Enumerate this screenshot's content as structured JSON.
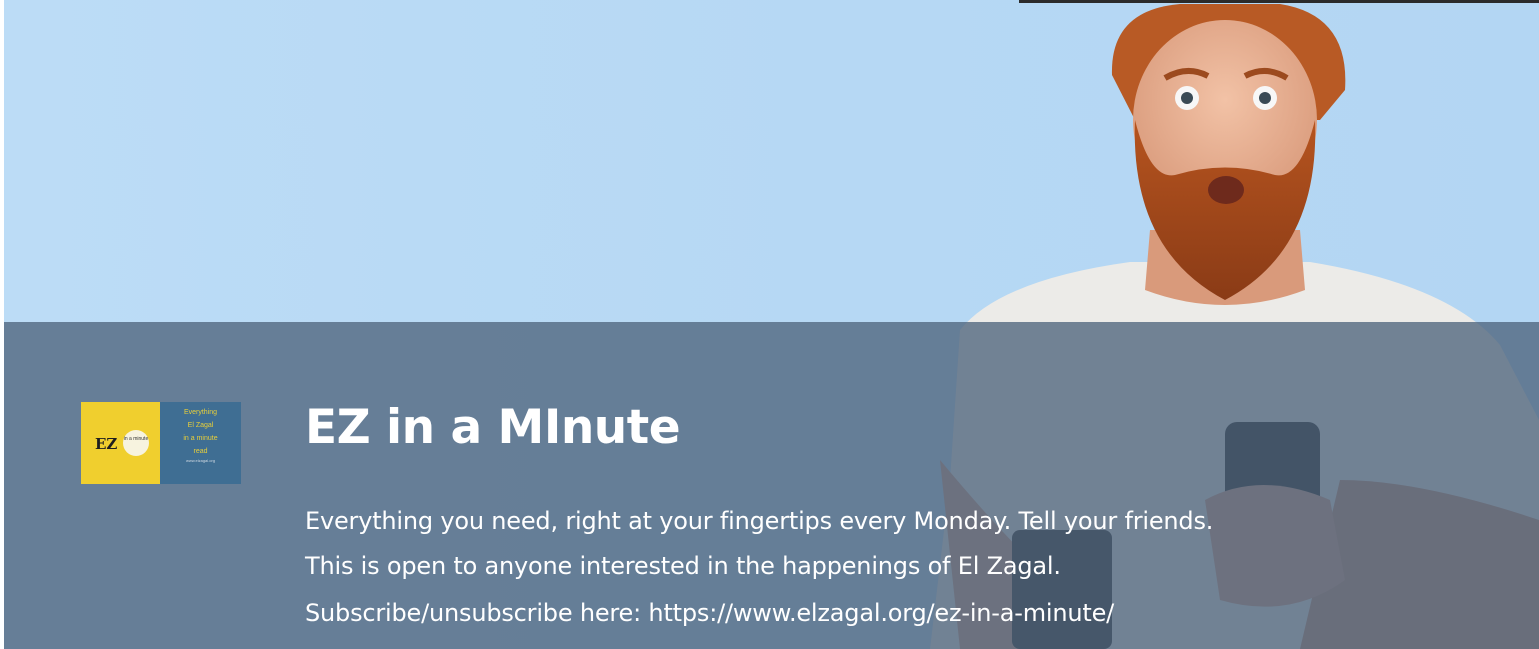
{
  "banner": {
    "title": "EZ in a MInute",
    "description_lines": [
      "Everything you need, right at your fingertips every Monday. Tell your friends.",
      "This is open to anyone interested in the happenings of El Zagal.",
      "Subscribe/unsubscribe here: https://www.elzagal.org/ez-in-a-minute/"
    ]
  },
  "logo": {
    "brand": "EZ",
    "badge_text": "in a minute",
    "tagline": [
      "Everything",
      "El Zagal",
      "in a minute",
      "read"
    ],
    "fine_print": "www.elzagal.org"
  },
  "colors": {
    "sky": "#b6d8f4",
    "panel": "#4e647c",
    "logo_yellow": "#f0cf2e",
    "logo_blue": "#3f6e93",
    "text": "#ffffff"
  },
  "photo": {
    "subject": "surprised-man-with-phone"
  }
}
